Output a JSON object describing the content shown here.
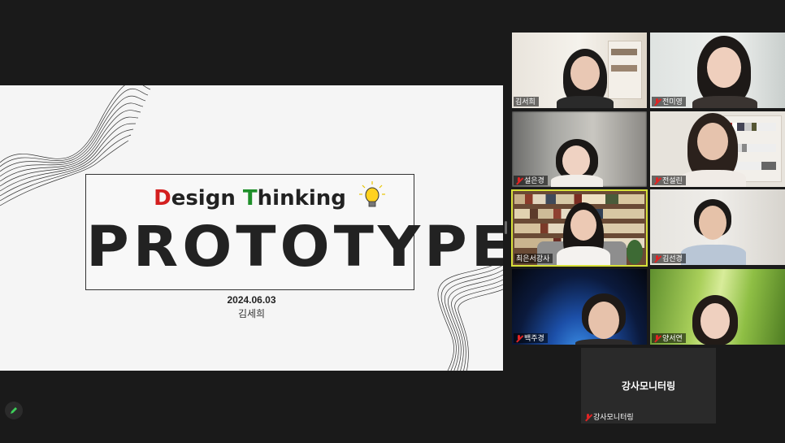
{
  "slide": {
    "design_word_1_first": "D",
    "design_word_1_rest": "esign ",
    "design_word_2_first": "T",
    "design_word_2_rest": "hinking",
    "main_title": "PROTOTYPE",
    "date": "2024.06.03",
    "author": "김세희"
  },
  "participants": [
    {
      "name": "김서희",
      "muted": false
    },
    {
      "name": "전미영",
      "muted": true
    },
    {
      "name": "설은경",
      "muted": true
    },
    {
      "name": "전설린",
      "muted": true
    },
    {
      "name": "최은서강사",
      "muted": false,
      "active_speaker": true
    },
    {
      "name": "김선경",
      "muted": true
    },
    {
      "name": "백주경",
      "muted": true
    },
    {
      "name": "양서연",
      "muted": true
    },
    {
      "name": "강사모니터링",
      "muted": true,
      "video_off": true,
      "center_label": "강사모니터링"
    }
  ],
  "colors": {
    "background": "#1a1a1a",
    "active_speaker_border": "#d7e03a",
    "muted_icon": "#e02424",
    "accent_red": "#d41f1f",
    "accent_green": "#1f8f2a"
  },
  "icons": [
    "mic-off-icon",
    "lightbulb-icon",
    "pen-icon"
  ]
}
